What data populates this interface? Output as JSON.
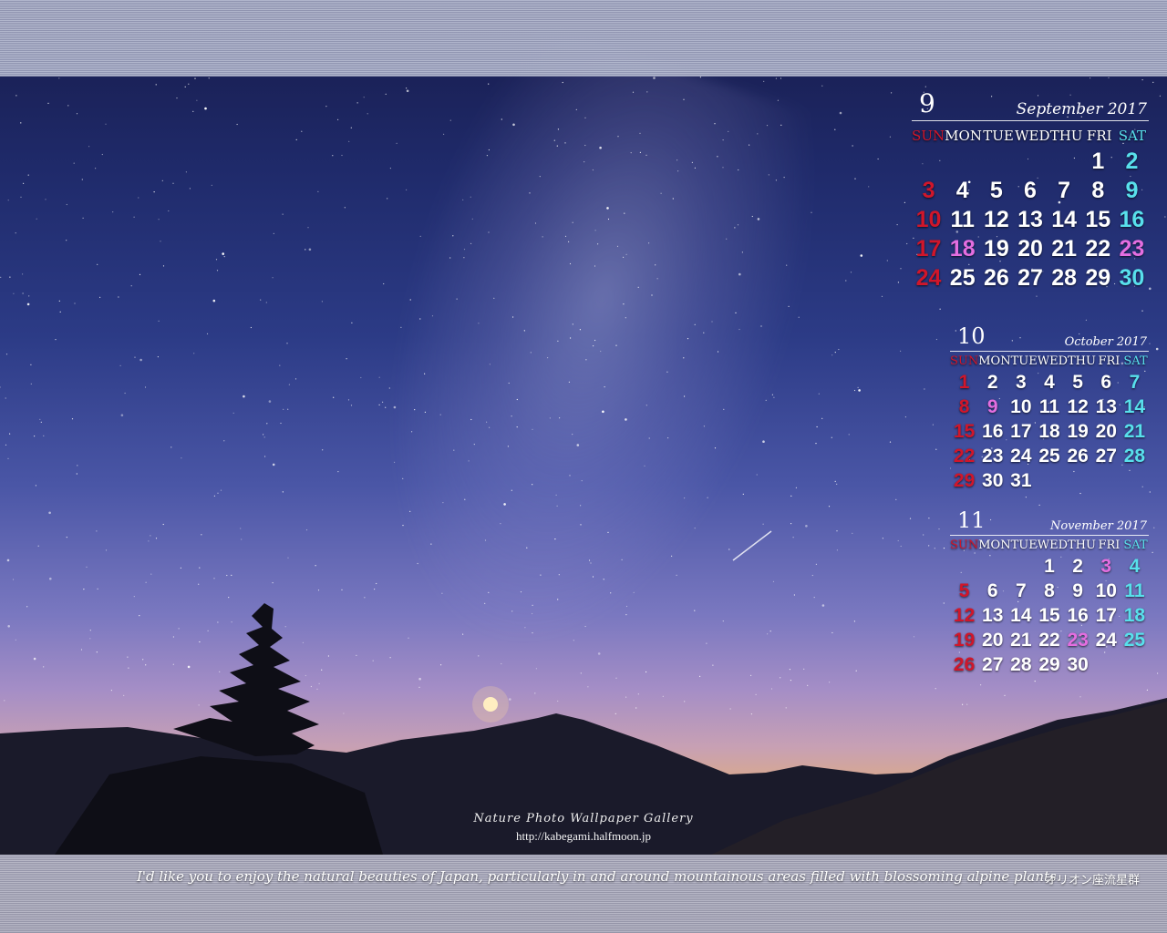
{
  "calendars": [
    {
      "month_number": "9",
      "month_name": "September 2017",
      "day_names": [
        "SUN",
        "MON",
        "TUE",
        "WED",
        "THU",
        "FRI",
        "SAT"
      ],
      "weeks": [
        [
          "",
          "",
          "",
          "",
          "",
          "1",
          "2"
        ],
        [
          "3",
          "4",
          "5",
          "6",
          "7",
          "8",
          "9"
        ],
        [
          "10",
          "11",
          "12",
          "13",
          "14",
          "15",
          "16"
        ],
        [
          "17",
          "18",
          "19",
          "20",
          "21",
          "22",
          "23"
        ],
        [
          "24",
          "25",
          "26",
          "27",
          "28",
          "29",
          "30"
        ]
      ],
      "holidays": [
        "18",
        "23"
      ]
    },
    {
      "month_number": "10",
      "month_name": "October 2017",
      "day_names": [
        "SUN",
        "MON",
        "TUE",
        "WED",
        "THU",
        "FRI",
        "SAT"
      ],
      "weeks": [
        [
          "1",
          "2",
          "3",
          "4",
          "5",
          "6",
          "7"
        ],
        [
          "8",
          "9",
          "10",
          "11",
          "12",
          "13",
          "14"
        ],
        [
          "15",
          "16",
          "17",
          "18",
          "19",
          "20",
          "21"
        ],
        [
          "22",
          "23",
          "24",
          "25",
          "26",
          "27",
          "28"
        ],
        [
          "29",
          "30",
          "31",
          "",
          "",
          "",
          ""
        ]
      ],
      "holidays": [
        "9"
      ]
    },
    {
      "month_number": "11",
      "month_name": "November 2017",
      "day_names": [
        "SUN",
        "MON",
        "TUE",
        "WED",
        "THU",
        "FRI",
        "SAT"
      ],
      "weeks": [
        [
          "",
          "",
          "",
          "1",
          "2",
          "3",
          "4"
        ],
        [
          "5",
          "6",
          "7",
          "8",
          "9",
          "10",
          "11"
        ],
        [
          "12",
          "13",
          "14",
          "15",
          "16",
          "17",
          "18"
        ],
        [
          "19",
          "20",
          "21",
          "22",
          "23",
          "24",
          "25"
        ],
        [
          "26",
          "27",
          "28",
          "29",
          "30",
          "",
          ""
        ]
      ],
      "holidays": [
        "3",
        "23"
      ]
    }
  ],
  "gallery_title": "Nature Photo Wallpaper Gallery",
  "url": "http://kabegami.halfmoon.jp",
  "tagline": "I'd like you to enjoy the natural beauties of Japan, particularly in and around mountainous areas filled with blossoming alpine plants.",
  "photo_title": "オリオン座流星群",
  "colors": {
    "sunday": "#d0162a",
    "saturday": "#58e0ec",
    "holiday": "#e46ee0"
  }
}
